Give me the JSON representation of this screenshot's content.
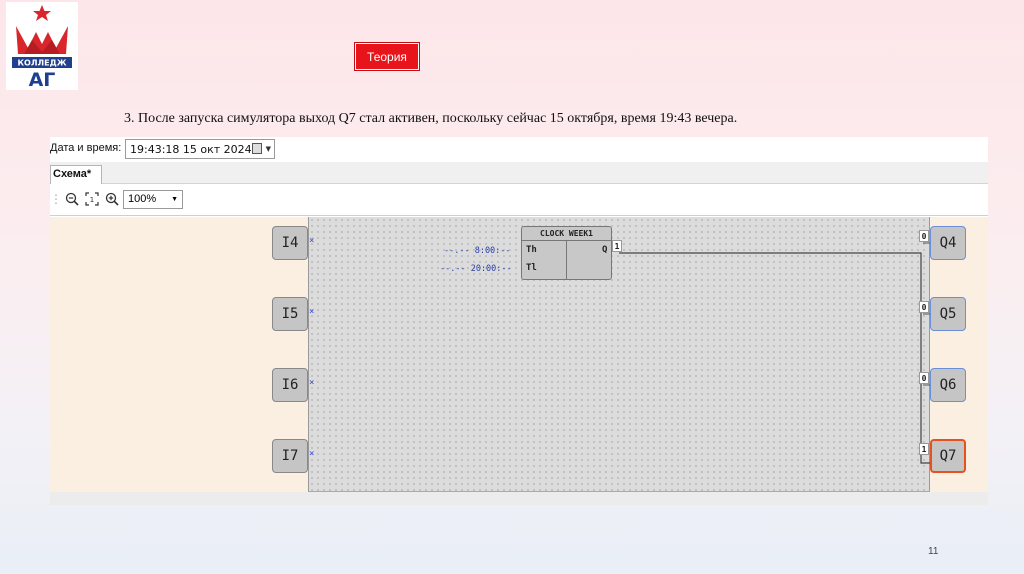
{
  "slide": {
    "logo_text": "КОЛЛЕДЖ",
    "logo_letters": "АГ",
    "theory_label": "Теория",
    "caption": "3. После запуска симулятора выход Q7 стал активен, поскольку сейчас 15 октября, время 19:43 вечера.",
    "page_number": "11"
  },
  "app": {
    "datetime_label": "Дата и время:",
    "datetime_value": "19:43:18  15  окт  2024",
    "tab_label": "Схема*",
    "zoom_value": "100%",
    "toolbar_icons": [
      "zoom-out-icon",
      "fit-icon",
      "zoom-in-icon"
    ]
  },
  "diagram": {
    "inputs": [
      "I4",
      "I5",
      "I6",
      "I7"
    ],
    "outputs": [
      {
        "label": "Q4",
        "state": "0",
        "active": false
      },
      {
        "label": "Q5",
        "state": "0",
        "active": false
      },
      {
        "label": "Q6",
        "state": "0",
        "active": false
      },
      {
        "label": "Q7",
        "state": "1",
        "active": true
      }
    ],
    "clock": {
      "title": "CLOCK WEEK1",
      "port_th": "Th",
      "port_tl": "Tl",
      "port_q": "Q",
      "q_state": "1",
      "param_th": "--.-- 8:00:--",
      "param_tl": "--.-- 20:00:--"
    }
  },
  "colors": {
    "accent_red": "#e8141b",
    "active_output_border": "#e5511f",
    "output_border": "#6a8fd8",
    "param_text": "#2b3fa8"
  }
}
